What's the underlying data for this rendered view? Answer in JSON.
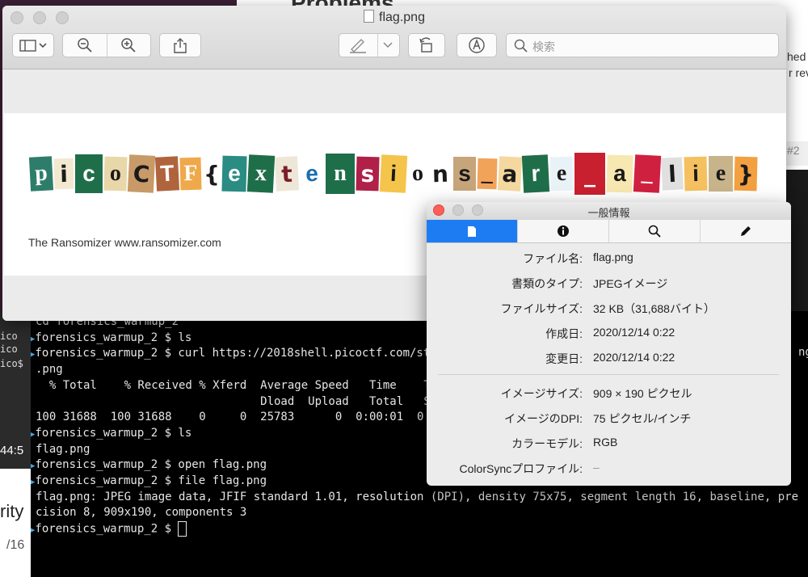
{
  "preview": {
    "title": "flag.png",
    "search_placeholder": "検索",
    "caption": "The Ransomizer www.ransomizer.com",
    "ransom_letters": [
      {
        "ch": "p",
        "bg": "#2e7d6b",
        "fg": "#ffffff"
      },
      {
        "ch": "i",
        "bg": "#f2e9d0",
        "fg": "#1a1a1a"
      },
      {
        "ch": "c",
        "bg": "#1f6e4a",
        "fg": "#ffffff"
      },
      {
        "ch": "o",
        "bg": "#e8d7a8",
        "fg": "#1a1a1a"
      },
      {
        "ch": "C",
        "bg": "#c79a68",
        "fg": "#1a1a1a"
      },
      {
        "ch": "T",
        "bg": "#b0643e",
        "fg": "#ffffff"
      },
      {
        "ch": "F",
        "bg": "#efa94a",
        "fg": "#ffffff"
      },
      {
        "ch": "{",
        "bg": "#ffffff",
        "fg": "#1a1a1a"
      },
      {
        "ch": "e",
        "bg": "#2a8c83",
        "fg": "#ffffff"
      },
      {
        "ch": "x",
        "bg": "#1f6e4a",
        "fg": "#ffffff"
      },
      {
        "ch": "t",
        "bg": "#eee6d7",
        "fg": "#7a1f2a"
      },
      {
        "ch": "e",
        "bg": "#ffffff",
        "fg": "#1a6fb0"
      },
      {
        "ch": "n",
        "bg": "#1f6e4a",
        "fg": "#ffffff"
      },
      {
        "ch": "s",
        "bg": "#b02048",
        "fg": "#ffffff"
      },
      {
        "ch": "i",
        "bg": "#f5c44a",
        "fg": "#1a1a1a"
      },
      {
        "ch": "o",
        "bg": "#ffffff",
        "fg": "#1a1a1a"
      },
      {
        "ch": "n",
        "bg": "#ffffff",
        "fg": "#1a1a1a"
      },
      {
        "ch": "s",
        "bg": "#c7a57a",
        "fg": "#1a1a1a"
      },
      {
        "ch": "_",
        "bg": "#f2a35a",
        "fg": "#1a1a1a"
      },
      {
        "ch": "a",
        "bg": "#f5d8a0",
        "fg": "#1a1a1a"
      },
      {
        "ch": "r",
        "bg": "#1f6e4a",
        "fg": "#ffffff"
      },
      {
        "ch": "e",
        "bg": "#e9f3f7",
        "fg": "#1a1a1a"
      },
      {
        "ch": "_",
        "bg": "#c8202e",
        "fg": "#ffffff"
      },
      {
        "ch": "a",
        "bg": "#f7e7b0",
        "fg": "#1a1a1a"
      },
      {
        "ch": "_",
        "bg": "#d02040",
        "fg": "#ffffff"
      },
      {
        "ch": "l",
        "bg": "#e0e0e0",
        "fg": "#1a1a1a"
      },
      {
        "ch": "i",
        "bg": "#f5c060",
        "fg": "#1a1a1a"
      },
      {
        "ch": "e",
        "bg": "#c8b48a",
        "fg": "#1a1a1a"
      },
      {
        "ch": "}",
        "bg": "#f2a040",
        "fg": "#1a1a1a"
      }
    ]
  },
  "info": {
    "title": "一般情報",
    "rows": [
      {
        "key": "ファイル名:",
        "value": "flag.png"
      },
      {
        "key": "書類のタイプ:",
        "value": "JPEGイメージ"
      },
      {
        "key": "ファイルサイズ:",
        "value": "32 KB（31,688バイト）"
      },
      {
        "key": "作成日:",
        "value": "2020/12/14 0:22"
      },
      {
        "key": "変更日:",
        "value": "2020/12/14 0:22"
      },
      {
        "key": "イメージサイズ:",
        "value": "909 × 190 ピクセル"
      },
      {
        "key": "イメージのDPI:",
        "value": "75 ピクセル/インチ"
      },
      {
        "key": "カラーモデル:",
        "value": "RGB"
      },
      {
        "key": "ColorSyncプロファイル:",
        "value": "–"
      }
    ]
  },
  "terminal": {
    "lines": [
      {
        "arrow": false,
        "text": "cd forensics_warmup_2"
      },
      {
        "arrow": true,
        "text": "forensics_warmup_2 $ ls"
      },
      {
        "arrow": true,
        "text": "forensics_warmup_2 $ curl https://2018shell.picoctf.com/st"
      },
      {
        "arrow": false,
        "text": ".png"
      },
      {
        "arrow": false,
        "text": "  % Total    % Received % Xferd  Average Speed   Time    T"
      },
      {
        "arrow": false,
        "text": "                                 Dload  Upload   Total   S"
      },
      {
        "arrow": false,
        "text": "100 31688  100 31688    0     0  25783      0  0:00:01  0"
      },
      {
        "arrow": true,
        "text": "forensics_warmup_2 $ ls"
      },
      {
        "arrow": false,
        "text": "flag.png"
      },
      {
        "arrow": true,
        "text": "forensics_warmup_2 $ open flag.png"
      },
      {
        "arrow": true,
        "text": "forensics_warmup_2 $ file flag.png"
      },
      {
        "arrow": false,
        "text": "flag.png: JPEG image data, JFIF standard 1.01, resolution (DPI), density 75x75, segment length 16, baseline, pre"
      },
      {
        "arrow": false,
        "text": "cision 8, 909x190, components 3"
      },
      {
        "arrow": true,
        "text": "forensics_warmup_2 $ "
      }
    ],
    "right_fragment": "ng",
    "left_fragments": [
      "ico",
      "ico",
      "ico$"
    ]
  },
  "background": {
    "top_title": "Problems",
    "right_fragment_1": "hed p",
    "right_fragment_2": "r rev",
    "right_fragment_3": "#2",
    "left_time": "44:5",
    "left_text_1": "rity",
    "left_text_2": "/16"
  }
}
